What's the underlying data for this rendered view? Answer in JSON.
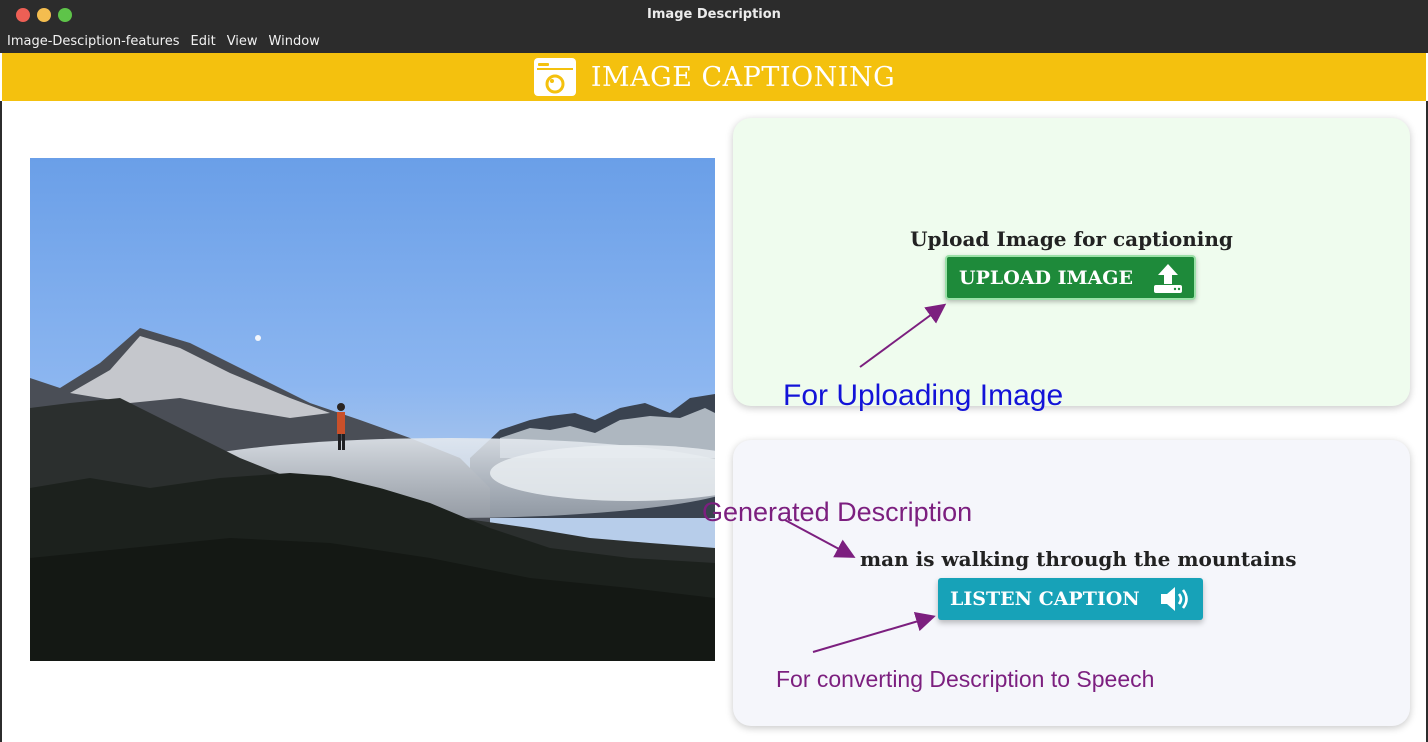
{
  "window": {
    "title": "Image Description",
    "menu": [
      "Image-Desciption-features",
      "Edit",
      "View",
      "Window"
    ]
  },
  "header": {
    "title": "IMAGE CAPTIONING",
    "background": "#f4c10e"
  },
  "upload_card": {
    "heading": "Upload Image for captioning",
    "button_label": "UPLOAD IMAGE",
    "button_icon": "upload-icon",
    "button_color": "#1e8a3a"
  },
  "description_card": {
    "caption": "man is walking through the mountains",
    "button_label": "LISTEN CAPTION",
    "button_icon": "speaker-icon",
    "button_color": "#17a2b8"
  },
  "annotations": {
    "upload": "For Uploading Image",
    "generated": "Generated Description",
    "speech": "For converting Description to Speech"
  }
}
